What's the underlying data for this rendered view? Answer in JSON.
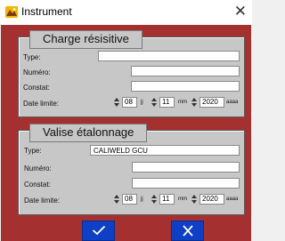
{
  "window": {
    "title": "Instrument"
  },
  "charge": {
    "title": "Charge résisitive",
    "type_label": "Type:",
    "type_value": "",
    "numero_label": "Numéro:",
    "numero_value": "",
    "constat_label": "Constat:",
    "constat_value": "",
    "date_label": "Date limite:",
    "day": "08",
    "day_unit": "jj",
    "month": "11",
    "month_unit": "mm",
    "year": "2020",
    "year_unit": "aaaa"
  },
  "valise": {
    "title": "Valise étalonnage",
    "type_label": "Type:",
    "type_value": "CALIWELD GCU",
    "numero_label": "Numéro:",
    "numero_value": "",
    "constat_label": "Constat:",
    "constat_value": "",
    "date_label": "Date limite:",
    "day": "08",
    "day_unit": "jj",
    "month": "11",
    "month_unit": "mm",
    "year": "2020",
    "year_unit": "aaaa"
  },
  "buttons": {
    "ok_icon": "checkmark-icon",
    "cancel_icon": "x-icon"
  },
  "colors": {
    "dialog_bg": "#a43030",
    "panel_bg": "#c7c7c7",
    "button_bg": "#0f3fc5",
    "app_icon": "#f4b400"
  }
}
